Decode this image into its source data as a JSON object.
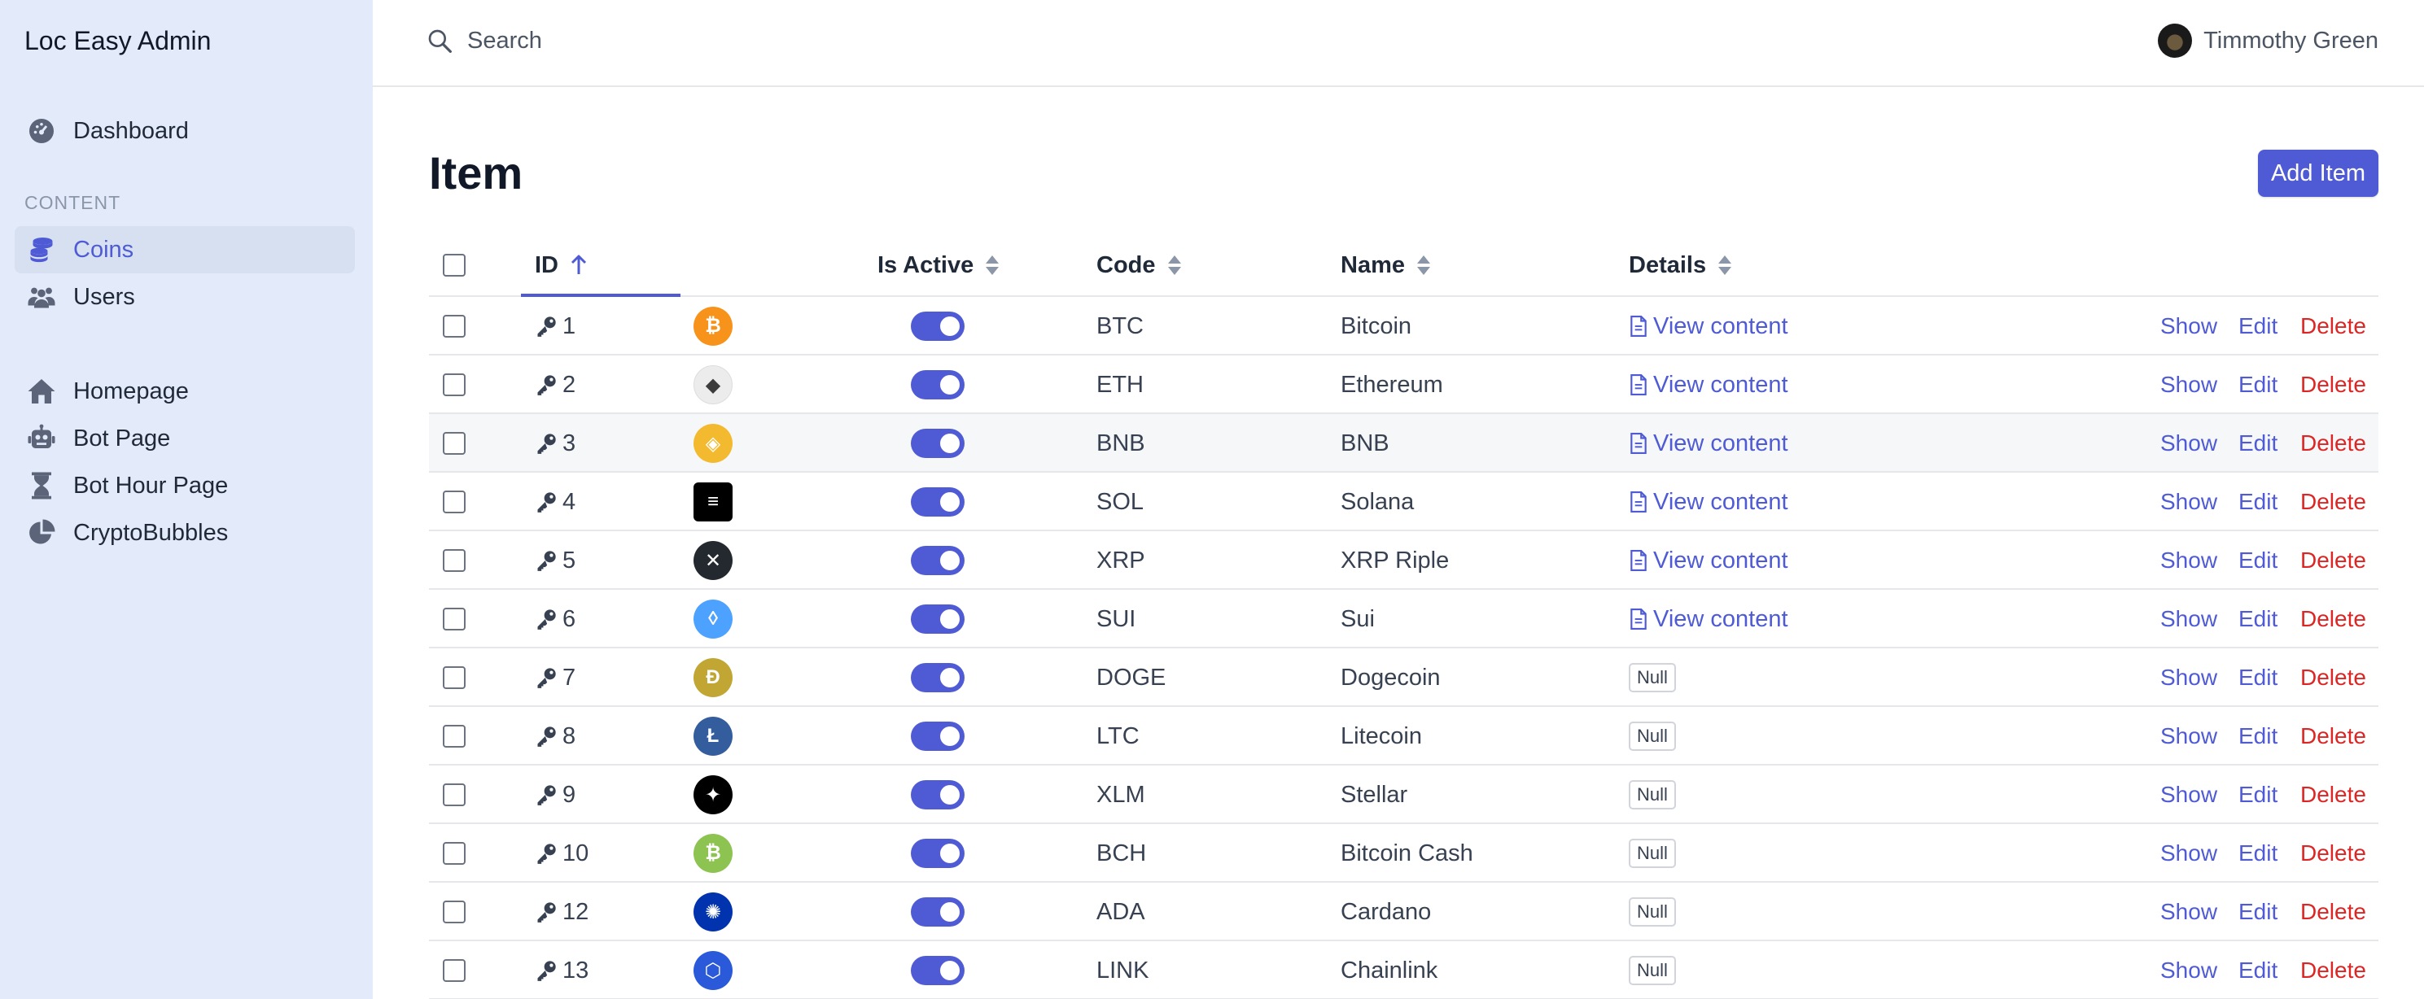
{
  "app": {
    "title": "Loc Easy Admin"
  },
  "sidebar": {
    "top_items": [
      {
        "label": "Dashboard",
        "icon": "dashboard-icon"
      }
    ],
    "section_label": "CONTENT",
    "content_items": [
      {
        "label": "Coins",
        "icon": "coins-icon",
        "active": true
      },
      {
        "label": "Users",
        "icon": "users-icon"
      }
    ],
    "page_items": [
      {
        "label": "Homepage",
        "icon": "home-icon"
      },
      {
        "label": "Bot Page",
        "icon": "robot-icon"
      },
      {
        "label": "Bot Hour Page",
        "icon": "hourglass-icon"
      },
      {
        "label": "CryptoBubbles",
        "icon": "pie-chart-icon"
      }
    ]
  },
  "topbar": {
    "search_placeholder": "Search",
    "user_name": "Timmothy Green"
  },
  "page": {
    "title": "Item",
    "add_button": "Add Item"
  },
  "table": {
    "headers": {
      "id": "ID",
      "is_active": "Is Active",
      "code": "Code",
      "name": "Name",
      "details": "Details"
    },
    "sorted_by": "ID",
    "sort_direction": "ascending",
    "actions": {
      "show": "Show",
      "edit": "Edit",
      "delete": "Delete"
    },
    "view_content_label": "View content",
    "null_label": "Null",
    "rows": [
      {
        "id": "1",
        "code": "BTC",
        "name": "Bitcoin",
        "active": true,
        "details": "link",
        "logo_color": "#f7931a",
        "logo": "bitcoin-logo"
      },
      {
        "id": "2",
        "code": "ETH",
        "name": "Ethereum",
        "active": true,
        "details": "link",
        "logo_color": "#ececec",
        "logo": "ethereum-logo"
      },
      {
        "id": "3",
        "code": "BNB",
        "name": "BNB",
        "active": true,
        "details": "link",
        "logo_color": "#f3ba2f",
        "logo": "bnb-logo"
      },
      {
        "id": "4",
        "code": "SOL",
        "name": "Solana",
        "active": true,
        "details": "link",
        "logo_color": "#000000",
        "logo": "solana-logo"
      },
      {
        "id": "5",
        "code": "XRP",
        "name": "XRP Riple",
        "active": true,
        "details": "link",
        "logo_color": "#23292f",
        "logo": "xrp-logo"
      },
      {
        "id": "6",
        "code": "SUI",
        "name": "Sui",
        "active": true,
        "details": "link",
        "logo_color": "#4da2ff",
        "logo": "sui-logo"
      },
      {
        "id": "7",
        "code": "DOGE",
        "name": "Dogecoin",
        "active": true,
        "details": "null",
        "logo_color": "#c2a633",
        "logo": "dogecoin-logo"
      },
      {
        "id": "8",
        "code": "LTC",
        "name": "Litecoin",
        "active": true,
        "details": "null",
        "logo_color": "#345d9d",
        "logo": "litecoin-logo"
      },
      {
        "id": "9",
        "code": "XLM",
        "name": "Stellar",
        "active": true,
        "details": "null",
        "logo_color": "#000000",
        "logo": "stellar-logo"
      },
      {
        "id": "10",
        "code": "BCH",
        "name": "Bitcoin Cash",
        "active": true,
        "details": "null",
        "logo_color": "#8dc351",
        "logo": "bitcoin-cash-logo"
      },
      {
        "id": "12",
        "code": "ADA",
        "name": "Cardano",
        "active": true,
        "details": "null",
        "logo_color": "#0033ad",
        "logo": "cardano-logo"
      },
      {
        "id": "13",
        "code": "LINK",
        "name": "Chainlink",
        "active": true,
        "details": "null",
        "logo_color": "#2a5ada",
        "logo": "chainlink-logo"
      }
    ]
  },
  "colors": {
    "accent": "#4f5bd5",
    "danger": "#dc2626",
    "sidebar_bg": "#e3ebfa"
  }
}
